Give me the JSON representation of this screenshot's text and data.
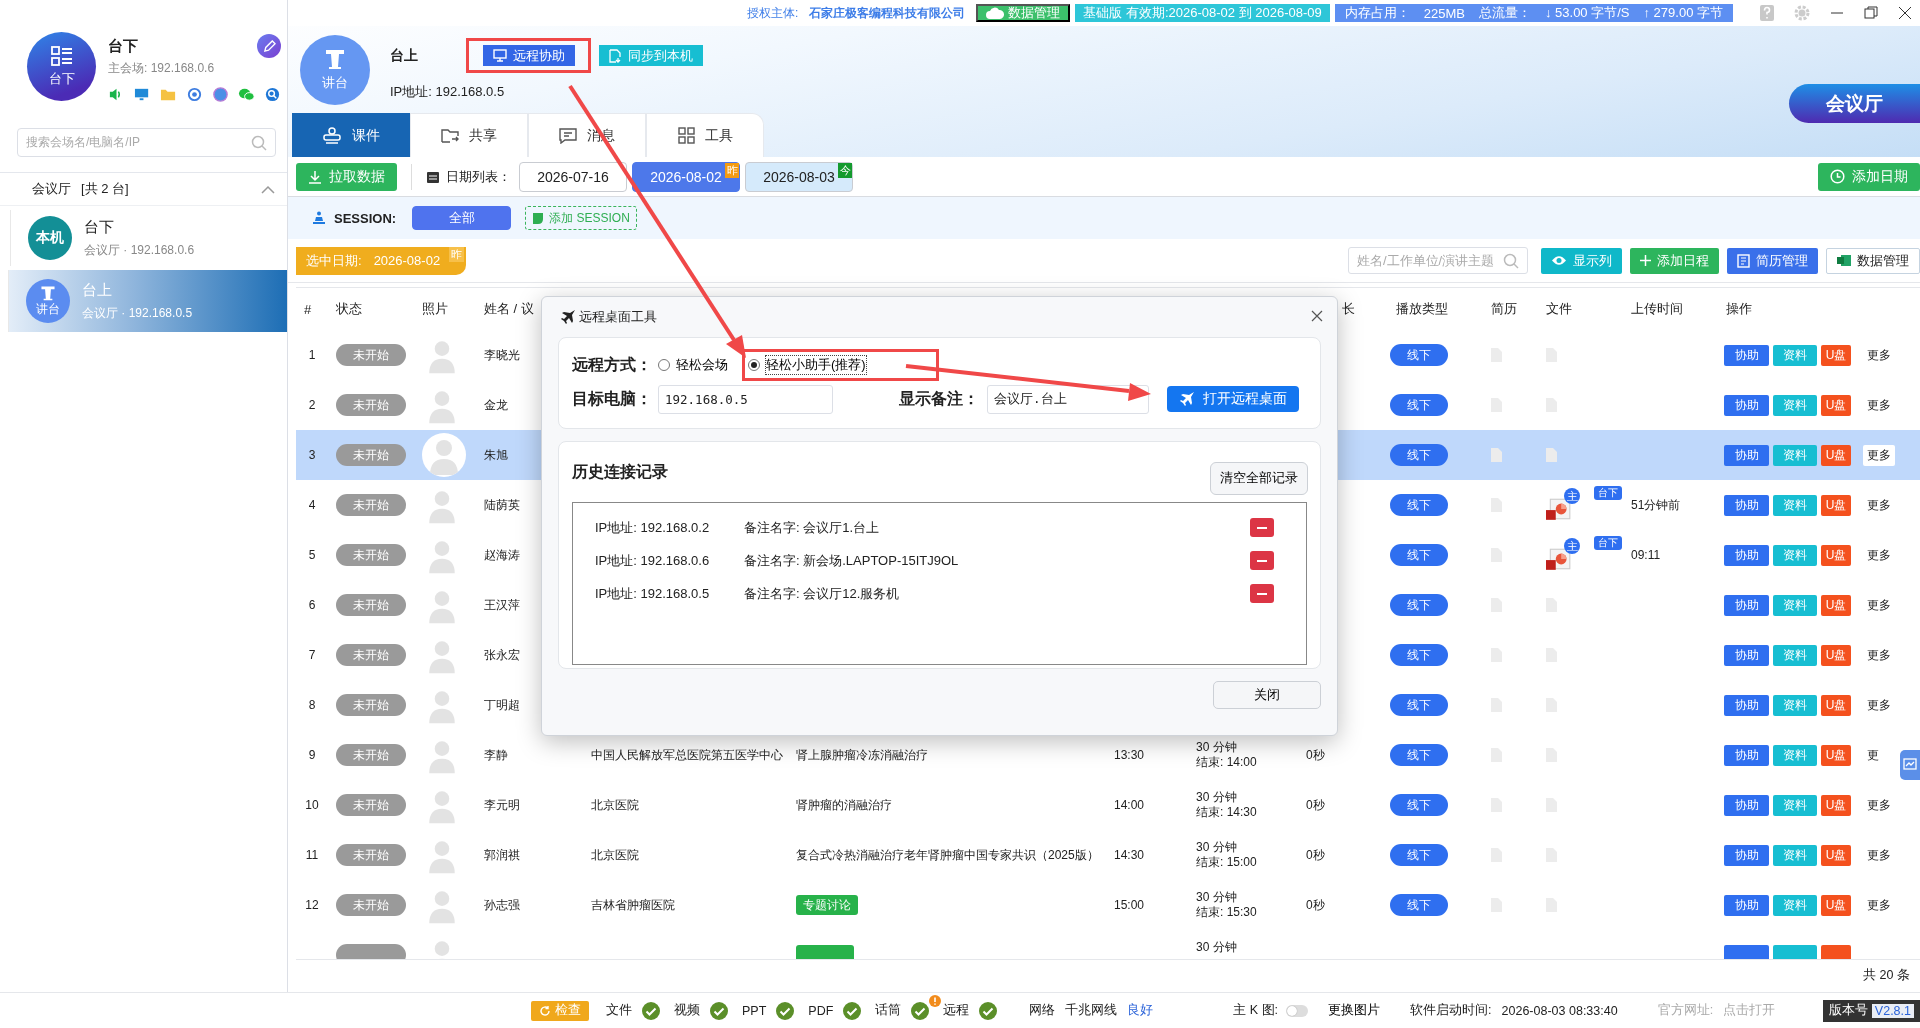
{
  "top_bar": {
    "license_label": "授权主体:",
    "company": "石家庄极客编程科技有限公司",
    "chips": [
      {
        "kind": "cloud",
        "text": "数据管理"
      },
      {
        "kind": "plan",
        "text": "基础版 有效期:2026-08-02 到 2026-08-09"
      }
    ],
    "memory_label": "内存占用：",
    "memory_value": "225MB",
    "flow_label": "总流量：",
    "down": "↓ 53.00 字节/S",
    "up": "↑ 279.00 字节"
  },
  "sidebar": {
    "profile": {
      "avatar_label": "台下",
      "name": "台下",
      "subtitle": "主会场: 192.168.0.6"
    },
    "search": {
      "placeholder": "搜索会场名/电脑名/IP"
    },
    "group": {
      "name": "会议厅",
      "count": "[共 2 台]",
      "expanded": true
    },
    "items": [
      {
        "kind": "local",
        "avatar_label": "本机",
        "name": "台下",
        "subtitle": "会议厅 · 192.168.0.6",
        "selected": false
      },
      {
        "kind": "podium",
        "avatar_label": "讲台",
        "name": "台上",
        "subtitle": "会议厅 · 192.168.0.5",
        "selected": true
      }
    ]
  },
  "header": {
    "avatar_label": "讲台",
    "name": "台上",
    "ip": "IP地址: 192.168.0.5",
    "buttons": [
      {
        "kind": "remote",
        "label": "远程协助",
        "highlighted": true
      },
      {
        "kind": "sync",
        "label": "同步到本机",
        "highlighted": false
      }
    ],
    "room": "会议厅"
  },
  "tabs": [
    {
      "kind": "courseware",
      "label": "课件",
      "selected": true
    },
    {
      "kind": "share",
      "label": "共享",
      "selected": false
    },
    {
      "kind": "message",
      "label": "消息",
      "selected": false
    },
    {
      "kind": "tools",
      "label": "工具",
      "selected": false
    }
  ],
  "toolbar": {
    "pull_button": "拉取数据",
    "date_list_label": "日期列表：",
    "dates": [
      {
        "date": "2026-07-16",
        "selected": false
      },
      {
        "date": "2026-08-02",
        "selected": true,
        "badge": {
          "text": "昨",
          "kind": "yesterday"
        }
      },
      {
        "date": "2026-08-03",
        "selected": false,
        "badge": {
          "text": "今",
          "kind": "today"
        }
      }
    ],
    "add_date_button": "添加日期"
  },
  "session": {
    "label": "SESSION:",
    "chips": [
      {
        "label": "全部",
        "selected": true
      }
    ],
    "add_button": "添加 SESSION"
  },
  "filter": {
    "selected_date_label": "选中日期:",
    "selected_date": "2026-08-02",
    "badge": "昨",
    "search_placeholder": "姓名/工作单位/演讲主题",
    "buttons": [
      {
        "kind": "columns",
        "label": "显示列"
      },
      {
        "kind": "add",
        "label": "添加日程"
      },
      {
        "kind": "resume",
        "label": "简历管理"
      },
      {
        "kind": "export",
        "label": "数据管理"
      }
    ]
  },
  "table": {
    "columns": [
      "#",
      "状态",
      "照片",
      "姓名 / 议",
      "长",
      "播放类型",
      "简历",
      "文件",
      "上传时间",
      "操作"
    ],
    "rows": [
      {
        "no": "1",
        "status": "未开始",
        "name": "李晓光",
        "play_type": "线下",
        "selected": false,
        "actions": [
          "协助",
          "资料",
          "U盘",
          "更多"
        ]
      },
      {
        "no": "2",
        "status": "未开始",
        "name": "金龙",
        "play_type": "线下",
        "selected": false,
        "actions": [
          "协助",
          "资料",
          "U盘",
          "更多"
        ]
      },
      {
        "no": "3",
        "status": "未开始",
        "name": "朱旭",
        "play_type": "线下",
        "selected": true,
        "actions": [
          "协助",
          "资料",
          "U盘",
          "更多"
        ]
      },
      {
        "no": "4",
        "status": "未开始",
        "name": "陆荫英",
        "play_type": "线下",
        "selected": false,
        "file_marker": "主",
        "file_badge": "台下",
        "upload_time": "51分钟前",
        "actions": [
          "协助",
          "资料",
          "U盘",
          "更多"
        ]
      },
      {
        "no": "5",
        "status": "未开始",
        "name": "赵海涛",
        "play_type": "线下",
        "selected": false,
        "file_marker": "主",
        "file_badge": "台下",
        "upload_time": "09:11",
        "actions": [
          "协助",
          "资料",
          "U盘",
          "更多"
        ]
      },
      {
        "no": "6",
        "status": "未开始",
        "name": "王汉萍",
        "play_type": "线下",
        "selected": false,
        "actions": [
          "协助",
          "资料",
          "U盘",
          "更多"
        ]
      },
      {
        "no": "7",
        "status": "未开始",
        "name": "张永宏",
        "play_type": "线下",
        "selected": false,
        "actions": [
          "协助",
          "资料",
          "U盘",
          "更多"
        ]
      },
      {
        "no": "8",
        "status": "未开始",
        "name": "丁明超",
        "play_type": "线下",
        "selected": false,
        "actions": [
          "协助",
          "资料",
          "U盘",
          "更多"
        ]
      },
      {
        "no": "9",
        "status": "未开始",
        "name": "李静",
        "institution": "中国人民解放军总医院第五医学中心",
        "topic": {
          "kind": "text",
          "text": "肾上腺肿瘤冷冻消融治疗"
        },
        "start": "13:30",
        "duration": "30 分钟",
        "end": "结束: 14:00",
        "elapsed": "0秒",
        "play_type": "线下",
        "selected": false,
        "actions": [
          "协助",
          "资料",
          "U盘",
          "更"
        ]
      },
      {
        "no": "10",
        "status": "未开始",
        "name": "李元明",
        "institution": "北京医院",
        "topic": {
          "kind": "text",
          "text": "肾肿瘤的消融治疗"
        },
        "start": "14:00",
        "duration": "30 分钟",
        "end": "结束: 14:30",
        "elapsed": "0秒",
        "play_type": "线下",
        "selected": false,
        "actions": [
          "协助",
          "资料",
          "U盘",
          "更多"
        ]
      },
      {
        "no": "11",
        "status": "未开始",
        "name": "郭润祺",
        "institution": "北京医院",
        "topic": {
          "kind": "text",
          "text": "复合式冷热消融治疗老年肾肿瘤中国专家共识（2025版）"
        },
        "start": "14:30",
        "duration": "30 分钟",
        "end": "结束: 15:00",
        "elapsed": "0秒",
        "play_type": "线下",
        "selected": false,
        "actions": [
          "协助",
          "资料",
          "U盘",
          "更多"
        ]
      },
      {
        "no": "12",
        "status": "未开始",
        "name": "孙志强",
        "institution": "吉林省肿瘤医院",
        "topic": {
          "kind": "tag",
          "text": "专题讨论"
        },
        "start": "15:00",
        "duration": "30 分钟",
        "end": "结束: 15:30",
        "elapsed": "0秒",
        "play_type": "线下",
        "selected": false,
        "actions": [
          "协助",
          "资料",
          "U盘",
          "更多"
        ]
      },
      {
        "duration": "30 分钟",
        "selected": false
      }
    ],
    "total": "共 20 条"
  },
  "dialog": {
    "title": "远程桌面工具",
    "mode_label": "远程方式：",
    "modes": [
      {
        "label": "轻松会场",
        "selected": false,
        "highlighted": false
      },
      {
        "label": "轻松小助手(推荐)",
        "selected": true,
        "highlighted": true
      }
    ],
    "target_label": "目标电脑：",
    "target_value": "192.168.0.5",
    "note_label": "显示备注：",
    "note_value": "会议厅.台上",
    "open_button": "打开远程桌面",
    "history_title": "历史连接记录",
    "clear_button": "清空全部记录",
    "history": [
      {
        "ip": "IP地址: 192.168.0.2",
        "note": "备注名字: 会议厅1.台上"
      },
      {
        "ip": "IP地址: 192.168.0.6",
        "note": "备注名字: 新会场.LAPTOP-15ITJ9OL"
      },
      {
        "ip": "IP地址: 192.168.0.5",
        "note": "备注名字: 会议厅12.服务机"
      }
    ],
    "close_button": "关闭"
  },
  "status_bar": {
    "check_button": "检查",
    "checks": [
      {
        "label": "文件",
        "ok": true,
        "alert": false
      },
      {
        "label": "视频",
        "ok": true,
        "alert": false
      },
      {
        "label": "PPT",
        "ok": true,
        "alert": false
      },
      {
        "label": "PDF",
        "ok": true,
        "alert": false
      },
      {
        "label": "话筒",
        "ok": true,
        "alert": true
      },
      {
        "label": "远程",
        "ok": true,
        "alert": false
      }
    ],
    "network_label": "网络",
    "network_type": "千兆网线",
    "network_state": "良好",
    "k_label": "主 K 图:",
    "k_toggle": {
      "on": false
    },
    "change_image": "更换图片",
    "start_label": "软件启动时间:",
    "start_time": "2026-08-03 08:33:40",
    "site_label": "官方网址:",
    "site_link": "点击打开",
    "version_label": "版本号",
    "version": "V2.8.1"
  }
}
